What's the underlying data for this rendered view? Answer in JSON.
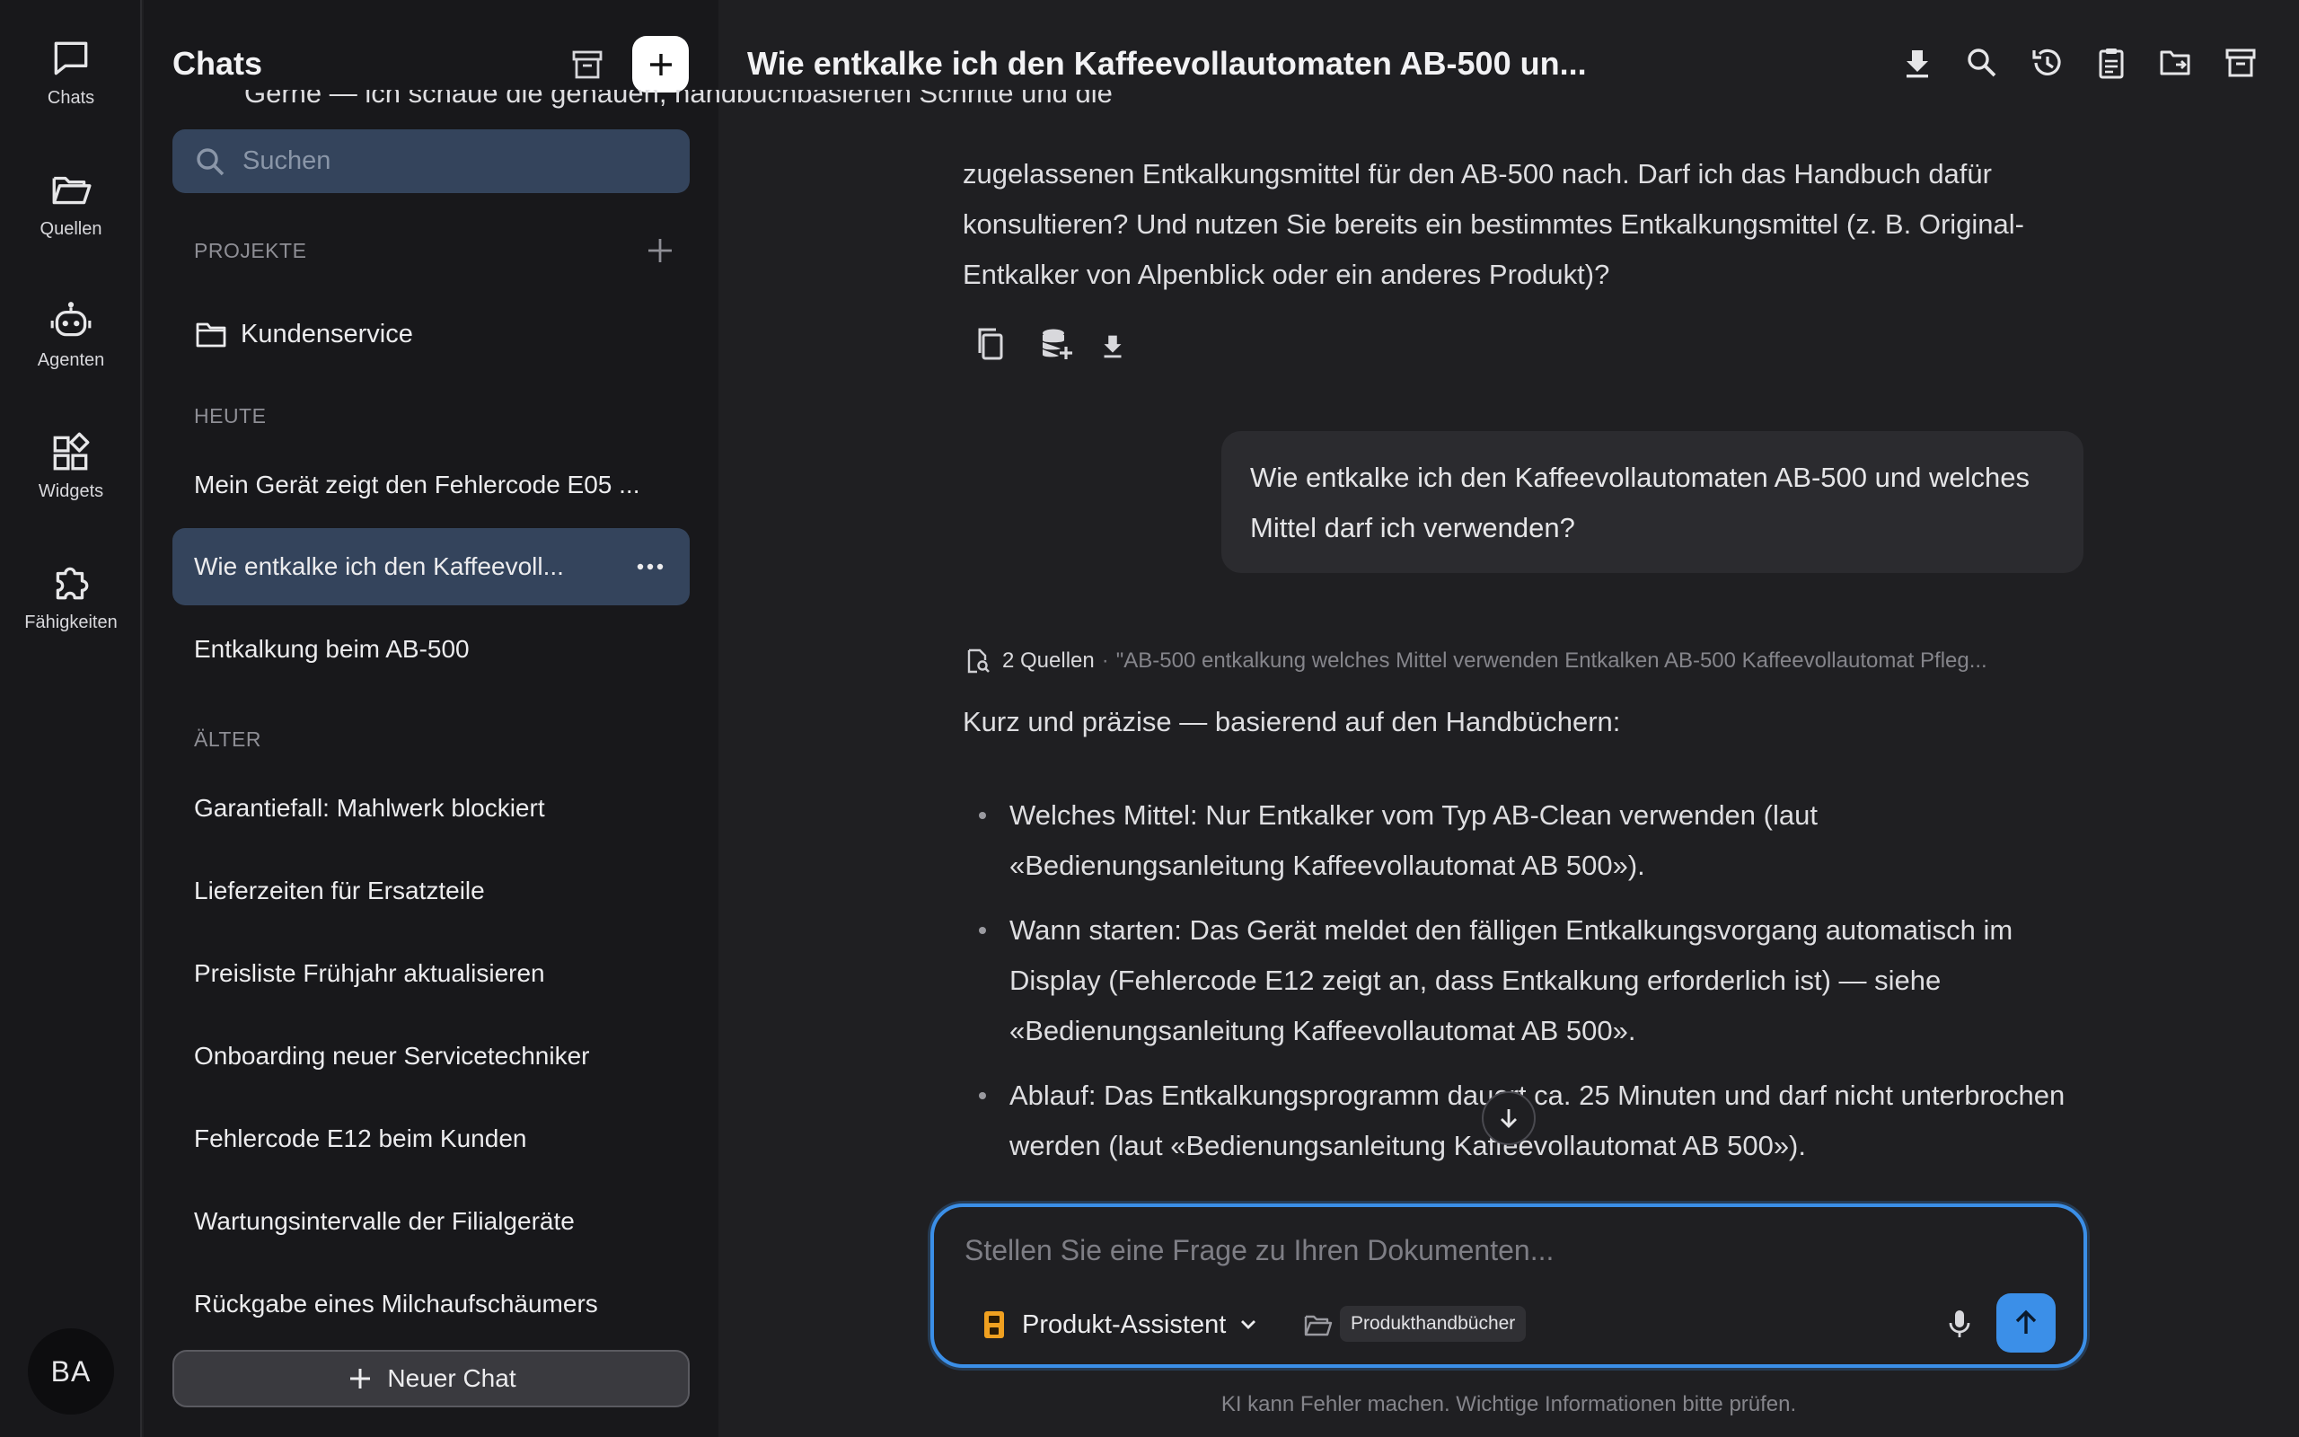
{
  "rail": {
    "items": [
      {
        "label": "Chats",
        "icon": "chat-bubble-icon"
      },
      {
        "label": "Quellen",
        "icon": "folder-open-icon"
      },
      {
        "label": "Agenten",
        "icon": "robot-icon"
      },
      {
        "label": "Widgets",
        "icon": "widgets-icon"
      },
      {
        "label": "Fähigkeiten",
        "icon": "puzzle-icon"
      }
    ],
    "avatar_initials": "BA"
  },
  "sidebar": {
    "title": "Chats",
    "search_placeholder": "Suchen",
    "projects_label": "PROJEKTE",
    "projects": [
      {
        "name": "Kundenservice"
      }
    ],
    "today_label": "HEUTE",
    "today": [
      {
        "title": "Mein Gerät zeigt den Fehlercode E05 ..."
      },
      {
        "title": "Wie entkalke ich den Kaffeevoll...",
        "active": true
      },
      {
        "title": "Entkalkung beim AB-500"
      }
    ],
    "older_label": "ÄLTER",
    "older": [
      {
        "title": "Garantiefall: Mahlwerk blockiert"
      },
      {
        "title": "Lieferzeiten für Ersatzteile"
      },
      {
        "title": "Preisliste Frühjahr aktualisieren"
      },
      {
        "title": "Onboarding neuer Servicetechniker"
      },
      {
        "title": "Fehlercode E12 beim Kunden"
      },
      {
        "title": "Wartungsintervalle der Filialgeräte"
      },
      {
        "title": "Rückgabe eines Milchaufschäumers"
      }
    ],
    "new_chat_label": "Neuer Chat"
  },
  "header": {
    "title": "Wie entkalke ich den Kaffeevollautomaten AB-500 un...",
    "icons": [
      "download-icon",
      "search-icon",
      "history-icon",
      "clipboard-icon",
      "move-to-folder-icon",
      "archive-icon"
    ]
  },
  "conversation": {
    "prev_partial_line": "Gerne — ich schaue die genauen, handbuchbasierten Schritte und die",
    "prev_text": "zugelassenen Entkalkungsmittel für den AB-500 nach. Darf ich das Handbuch dafür konsultieren? Und nutzen Sie bereits ein bestimmtes Entkalkungsmittel (z. B. Original-Entkalker von Alpenblick oder ein anderes Produkt)?",
    "user_message": "Wie entkalke ich den Kaffeevollautomaten AB-500 und welches Mittel darf ich verwenden?",
    "sources_count": "2 Quellen",
    "sources_query": "\"AB-500 entkalkung welches Mittel verwenden Entkalken AB-500 Kaffeevollautomat Pfleg...",
    "answer_intro": "Kurz und präzise — basierend auf den Handbüchern:",
    "answer_bullets": [
      "Welches Mittel: Nur Entkalker vom Typ AB-Clean verwenden (laut «Bedienungsanleitung Kaffeevollautomat AB 500»).",
      "Wann starten: Das Gerät meldet den fälligen Entkalkungsvorgang automatisch im Display (Fehlercode E12 zeigt an, dass Entkalkung erforderlich ist) — siehe «Bedienungsanleitung Kaffeevollautomat AB 500».",
      "Ablauf: Das Entkalkungsprogramm dauert ca. 25 Minuten und darf nicht unterbrochen werden (laut «Bedienungsanleitung Kaffeevollautomat AB 500»)."
    ]
  },
  "composer": {
    "placeholder": "Stellen Sie eine Frage zu Ihren Dokumenten...",
    "agent_name": "Produkt-Assistent",
    "knowledge_chip": "Produkthandbücher"
  },
  "footer": {
    "disclaimer": "KI kann Fehler machen. Wichtige Informationen bitte prüfen."
  },
  "colors": {
    "accent": "#3b8fe8",
    "active_item": "#34445c",
    "agent_icon": "#f0a020"
  }
}
